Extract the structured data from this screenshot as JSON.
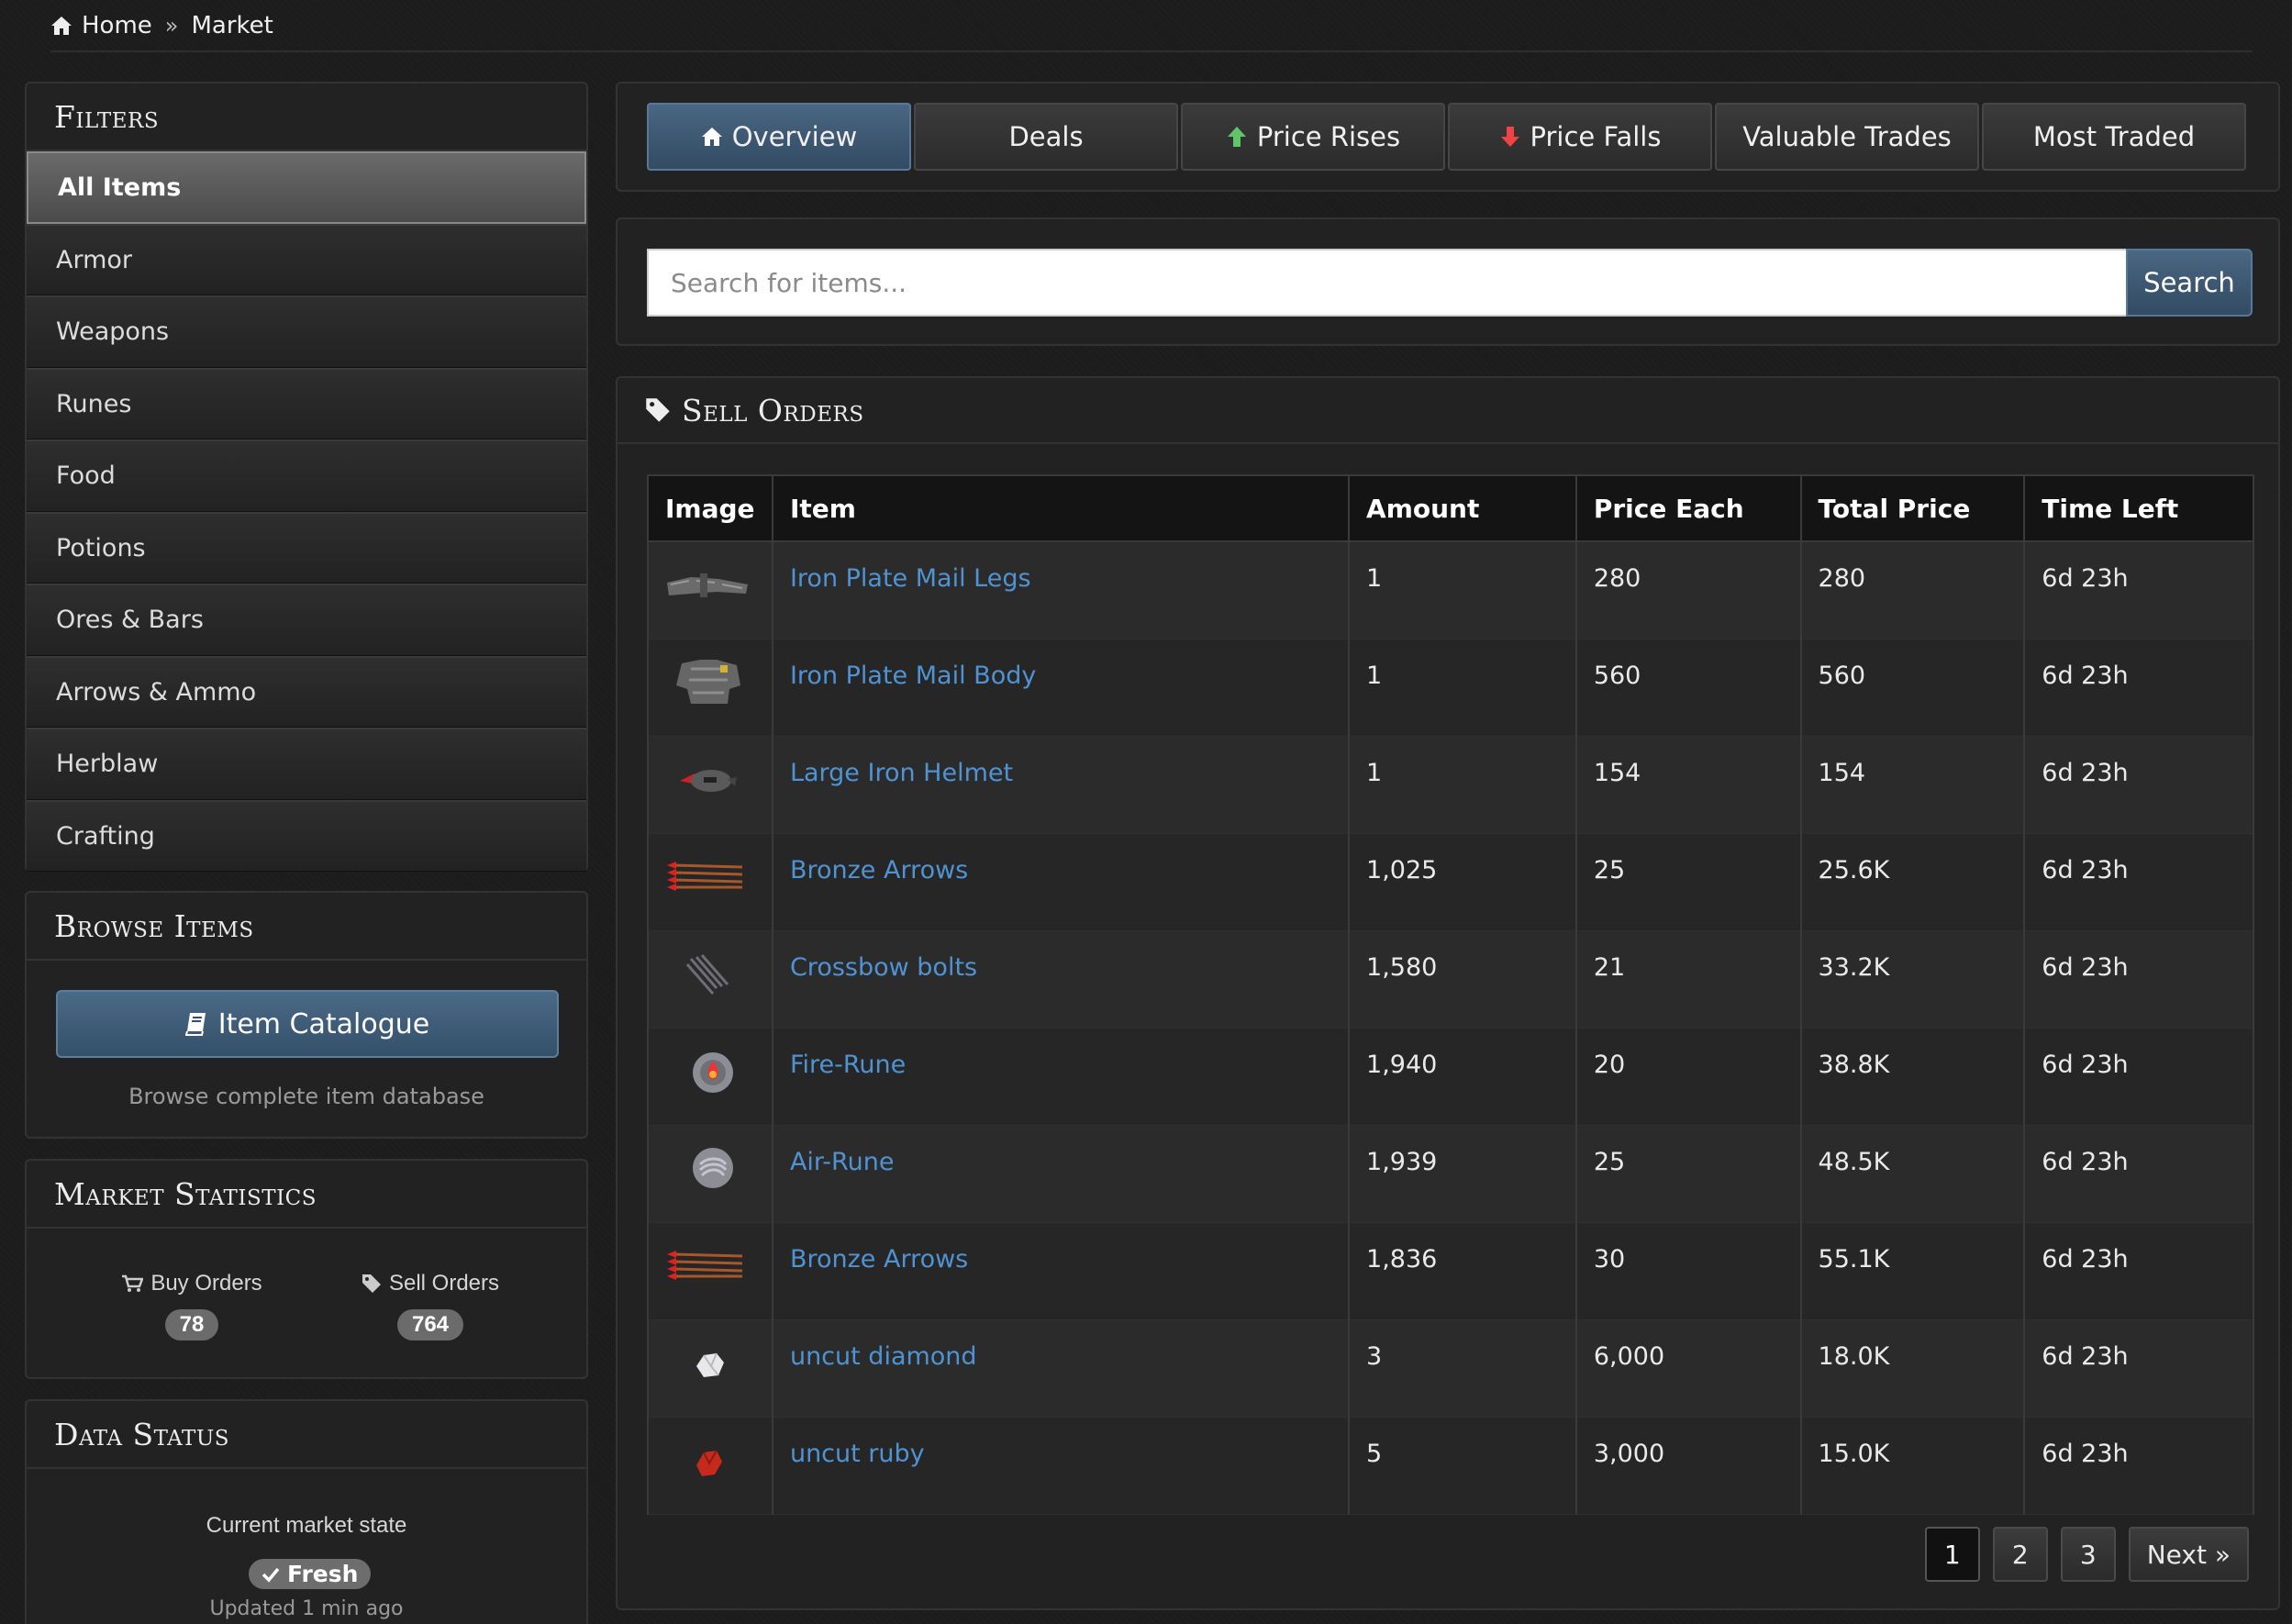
{
  "breadcrumb": {
    "home": "Home",
    "separator": "»",
    "current": "Market"
  },
  "filters": {
    "title": "Filters",
    "items": [
      "All Items",
      "Armor",
      "Weapons",
      "Runes",
      "Food",
      "Potions",
      "Ores & Bars",
      "Arrows & Ammo",
      "Herblaw",
      "Crafting"
    ],
    "active": "All Items"
  },
  "browse": {
    "title": "Browse Items",
    "button": "Item Catalogue",
    "note": "Browse complete item database"
  },
  "stats": {
    "title": "Market Statistics",
    "buy_label": "Buy Orders",
    "buy_count": "78",
    "sell_label": "Sell Orders",
    "sell_count": "764"
  },
  "status": {
    "title": "Data Status",
    "line1": "Current market state",
    "badge": "Fresh",
    "updated": "Updated 1 min ago"
  },
  "tabs": [
    "Overview",
    "Deals",
    "Price Rises",
    "Price Falls",
    "Valuable Trades",
    "Most Traded"
  ],
  "search": {
    "placeholder": "Search for items...",
    "button": "Search"
  },
  "orders": {
    "title": "Sell Orders",
    "columns": [
      "Image",
      "Item",
      "Amount",
      "Price Each",
      "Total Price",
      "Time Left"
    ],
    "rows": [
      {
        "icon": "plate-legs-icon",
        "item": "Iron Plate Mail Legs",
        "amount": "1",
        "price": "280",
        "total": "280",
        "time": "6d 23h"
      },
      {
        "icon": "plate-body-icon",
        "item": "Iron Plate Mail Body",
        "amount": "1",
        "price": "560",
        "total": "560",
        "time": "6d 23h"
      },
      {
        "icon": "helmet-icon",
        "item": "Large Iron Helmet",
        "amount": "1",
        "price": "154",
        "total": "154",
        "time": "6d 23h"
      },
      {
        "icon": "arrows-icon",
        "item": "Bronze Arrows",
        "amount": "1,025",
        "price": "25",
        "total": "25.6K",
        "time": "6d 23h"
      },
      {
        "icon": "bolts-icon",
        "item": "Crossbow bolts",
        "amount": "1,580",
        "price": "21",
        "total": "33.2K",
        "time": "6d 23h"
      },
      {
        "icon": "fire-rune-icon",
        "item": "Fire-Rune",
        "amount": "1,940",
        "price": "20",
        "total": "38.8K",
        "time": "6d 23h"
      },
      {
        "icon": "air-rune-icon",
        "item": "Air-Rune",
        "amount": "1,939",
        "price": "25",
        "total": "48.5K",
        "time": "6d 23h"
      },
      {
        "icon": "arrows-icon",
        "item": "Bronze Arrows",
        "amount": "1,836",
        "price": "30",
        "total": "55.1K",
        "time": "6d 23h"
      },
      {
        "icon": "diamond-icon",
        "item": "uncut diamond",
        "amount": "3",
        "price": "6,000",
        "total": "18.0K",
        "time": "6d 23h"
      },
      {
        "icon": "ruby-icon",
        "item": "uncut ruby",
        "amount": "5",
        "price": "3,000",
        "total": "15.0K",
        "time": "6d 23h"
      }
    ]
  },
  "pagination": {
    "pages": [
      "1",
      "2",
      "3"
    ],
    "current": "1",
    "next": "Next »"
  },
  "colors": {
    "accent": "#4a6682",
    "link": "#4f93d3",
    "background": "#1c1c1c",
    "panel": "#222222"
  }
}
